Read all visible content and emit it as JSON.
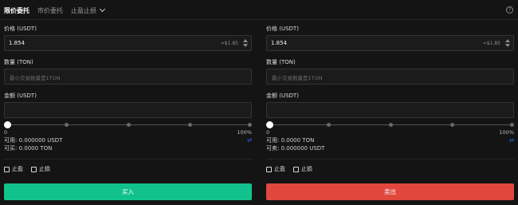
{
  "tabs": [
    "限价委托",
    "市价委托",
    "止盈止损"
  ],
  "buy": {
    "price_label": "价格 (USDT)",
    "price_value": "1.854",
    "price_approx": "≈$1.85",
    "qty_label": "数量 (TON)",
    "qty_placeholder": "最小交易数量是1TON",
    "amount_label": "金额 (USDT)",
    "slider_min": "0",
    "slider_max": "100%",
    "slider_level": 0,
    "avail1": "可用: 0.000000 USDT",
    "avail2": "可买: 0.0000 TON",
    "tp_label": "止盈",
    "sl_label": "止损",
    "button": "买入",
    "color": "#11c28d"
  },
  "sell": {
    "price_label": "价格 (USDT)",
    "price_value": "1.854",
    "price_approx": "≈$1.85",
    "qty_label": "数量 (TON)",
    "qty_placeholder": "最小交易数量是1TON",
    "amount_label": "金额 (USDT)",
    "slider_min": "0",
    "slider_max": "100%",
    "slider_level": 0,
    "avail1": "可用: 0.0000 TON",
    "avail2": "可卖: 0.000000 USDT",
    "tp_label": "止盈",
    "sl_label": "止损",
    "button": "卖出",
    "color": "#e0473d"
  },
  "icons": {
    "help": "help-circle-icon",
    "swap": "swap-arrows-icon"
  }
}
